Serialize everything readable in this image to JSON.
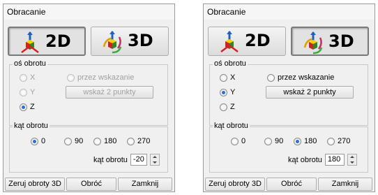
{
  "windows": [
    {
      "title": "Obracanie",
      "mode_2d_label": "2D",
      "mode_3d_label": "3D",
      "active_mode": "2D",
      "axis_group_label": "oś obrotu",
      "axis_x": "X",
      "axis_y": "Y",
      "axis_z": "Z",
      "axis_selected": "Z",
      "by_pointing_label": "przez wskazanie",
      "pick_two_points_label": "wskaż 2 punkty",
      "angle_group_label": "kąt obrotu",
      "angle_options": [
        "0",
        "90",
        "180",
        "270"
      ],
      "angle_selected": "0",
      "angle_field_label": "kąt obrotu",
      "angle_value": "-20",
      "reset_3d_label": "Zeruj obroty 3D",
      "rotate_label": "Obróć",
      "close_label": "Zamknij"
    },
    {
      "title": "Obracanie",
      "mode_2d_label": "2D",
      "mode_3d_label": "3D",
      "active_mode": "3D",
      "axis_group_label": "oś obrotu",
      "axis_x": "X",
      "axis_y": "Y",
      "axis_z": "Z",
      "axis_selected": "Y",
      "by_pointing_label": "przez wskazanie",
      "pick_two_points_label": "wskaż 2 punkty",
      "angle_group_label": "kąt obrotu",
      "angle_options": [
        "0",
        "90",
        "180",
        "270"
      ],
      "angle_selected": "180",
      "angle_field_label": "kąt obrotu",
      "angle_value": "180",
      "reset_3d_label": "Zeruj obroty 3D",
      "rotate_label": "Obróć",
      "close_label": "Zamknij"
    }
  ],
  "icons": {
    "mode_2d": "axes-cube-icon",
    "mode_3d": "axes-cube-rotate-icon"
  }
}
